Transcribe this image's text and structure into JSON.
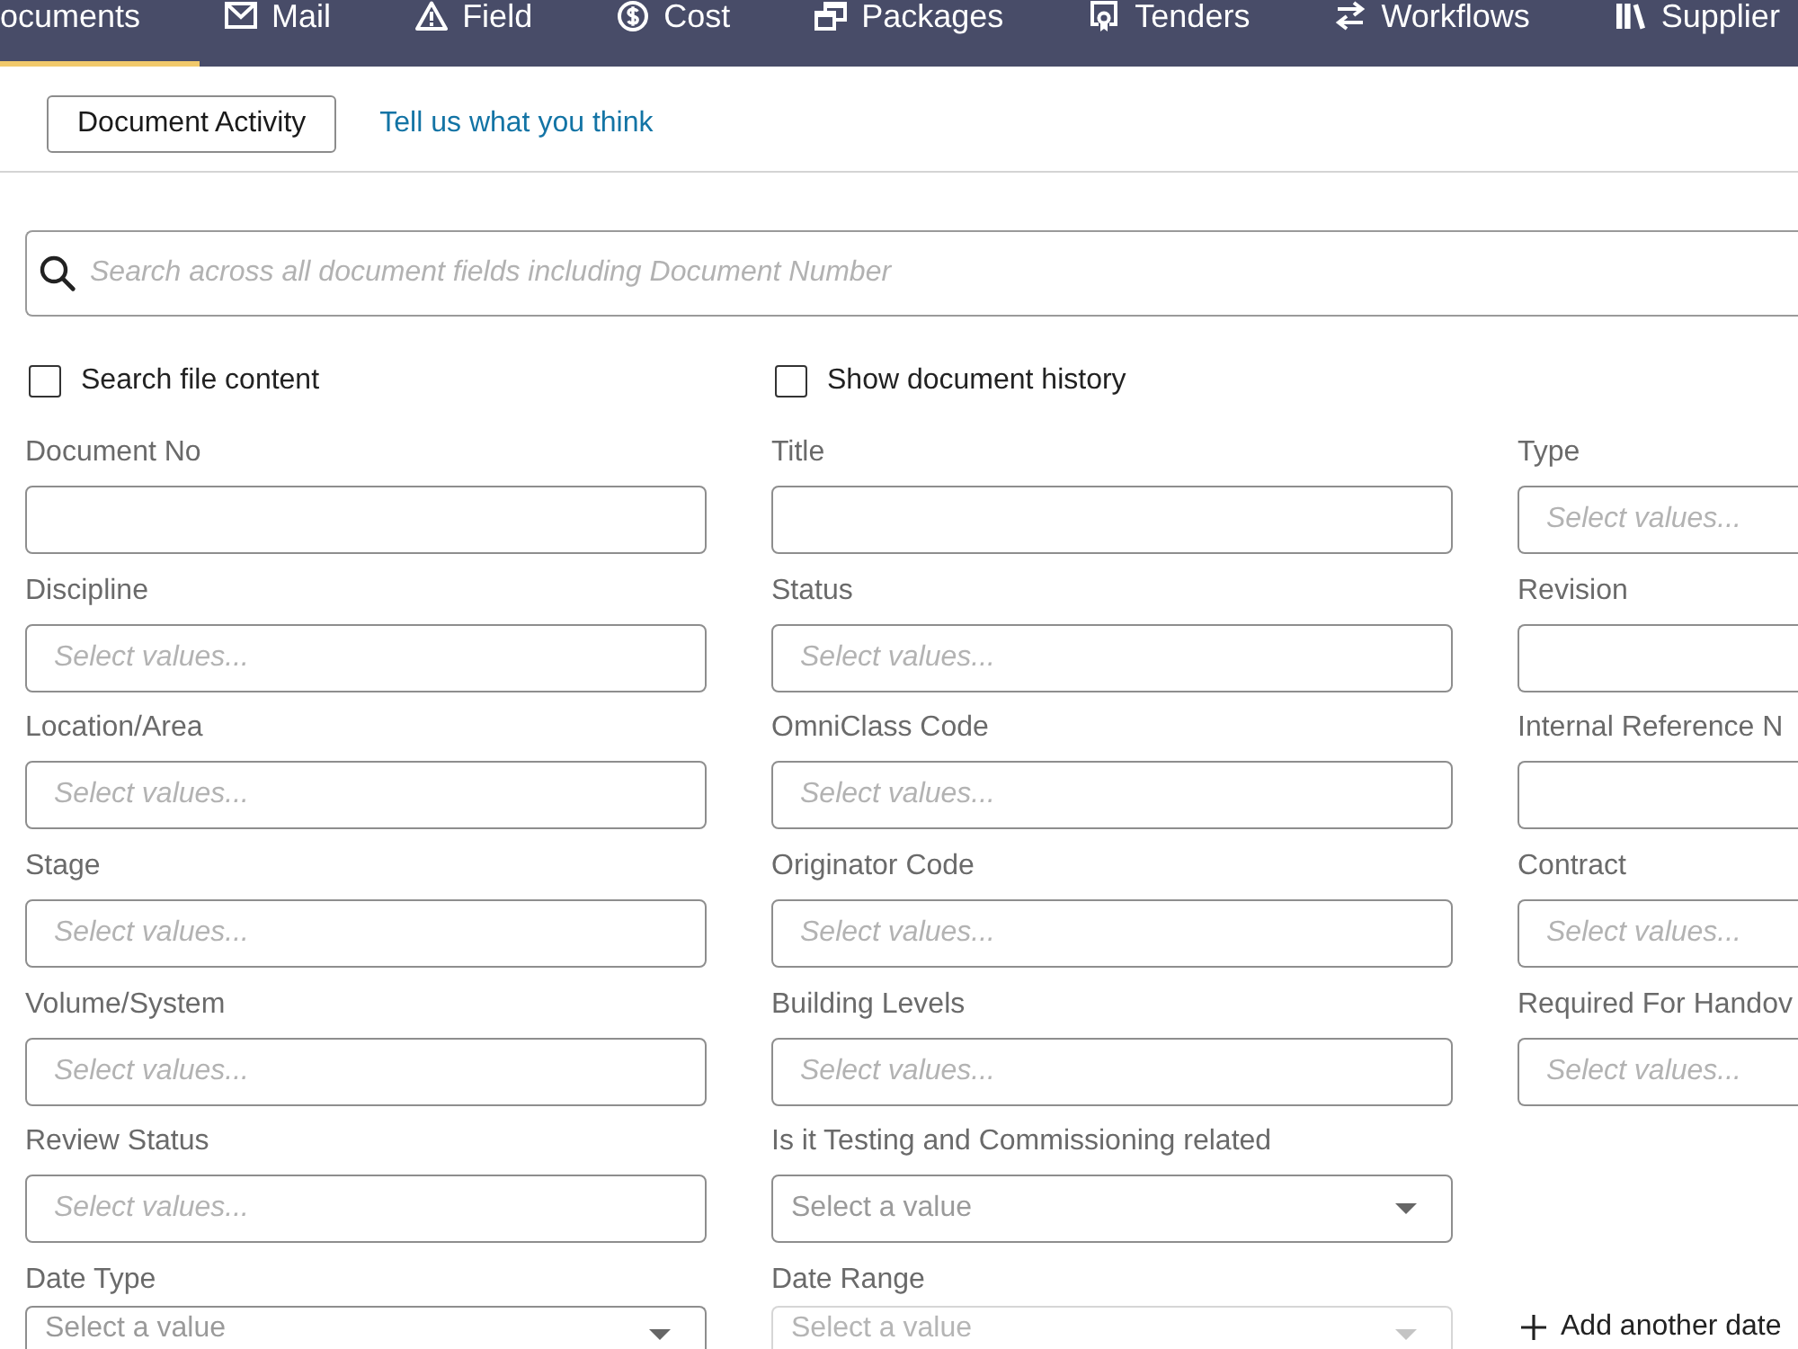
{
  "nav": {
    "tabs": [
      {
        "label": "ocuments",
        "selected": true
      },
      {
        "label": "Mail",
        "selected": false
      },
      {
        "label": "Field",
        "selected": false
      },
      {
        "label": "Cost",
        "selected": false
      },
      {
        "label": "Packages",
        "selected": false
      },
      {
        "label": "Tenders",
        "selected": false
      },
      {
        "label": "Workflows",
        "selected": false
      },
      {
        "label": "Supplier",
        "selected": false
      }
    ]
  },
  "toolbar": {
    "button": "Document Activity",
    "link": "Tell us what you think"
  },
  "search": {
    "placeholder": "Search across all document fields including Document Number"
  },
  "options": [
    {
      "label": "Search file content",
      "checked": false
    },
    {
      "label": "Show document history",
      "checked": false
    }
  ],
  "filter_rows": [
    [
      {
        "kind": "text",
        "label": "Document No",
        "disabled": false
      },
      {
        "kind": "text",
        "label": "Title",
        "disabled": false
      },
      {
        "kind": "multiselect",
        "label": "Type",
        "placeholder": "Select values...",
        "disabled": false
      }
    ],
    [
      {
        "kind": "multiselect",
        "label": "Discipline",
        "placeholder": "Select values...",
        "disabled": false
      },
      {
        "kind": "multiselect",
        "label": "Status",
        "placeholder": "Select values...",
        "disabled": false
      },
      {
        "kind": "text",
        "label": "Revision",
        "disabled": false
      }
    ],
    [
      {
        "kind": "multiselect",
        "label": "Location/Area",
        "placeholder": "Select values...",
        "disabled": false
      },
      {
        "kind": "multiselect",
        "label": "OmniClass Code",
        "placeholder": "Select values...",
        "disabled": false
      },
      {
        "kind": "text",
        "label": "Internal Reference N",
        "disabled": false
      }
    ],
    [
      {
        "kind": "multiselect",
        "label": "Stage",
        "placeholder": "Select values...",
        "disabled": false
      },
      {
        "kind": "multiselect",
        "label": "Originator Code",
        "placeholder": "Select values...",
        "disabled": false
      },
      {
        "kind": "multiselect",
        "label": "Contract",
        "placeholder": "Select values...",
        "disabled": false
      }
    ],
    [
      {
        "kind": "multiselect",
        "label": "Volume/System",
        "placeholder": "Select values...",
        "disabled": false
      },
      {
        "kind": "multiselect",
        "label": "Building Levels",
        "placeholder": "Select values...",
        "disabled": false
      },
      {
        "kind": "multiselect",
        "label": "Required For Handov",
        "placeholder": "Select values...",
        "disabled": false
      }
    ],
    [
      {
        "kind": "multiselect",
        "label": "Review Status",
        "placeholder": "Select values...",
        "disabled": false
      },
      {
        "kind": "dropdown",
        "label": "Is it Testing and Commissioning related",
        "placeholder": "Select a value",
        "disabled": false
      }
    ],
    [
      {
        "kind": "dropdown",
        "label": "Date Type",
        "placeholder": "Select a value",
        "disabled": false
      },
      {
        "kind": "dropdown",
        "label": "Date Range",
        "placeholder": "Select a value",
        "disabled": true
      },
      {
        "kind": "add",
        "label": "Add another date",
        "disabled": false
      }
    ]
  ]
}
